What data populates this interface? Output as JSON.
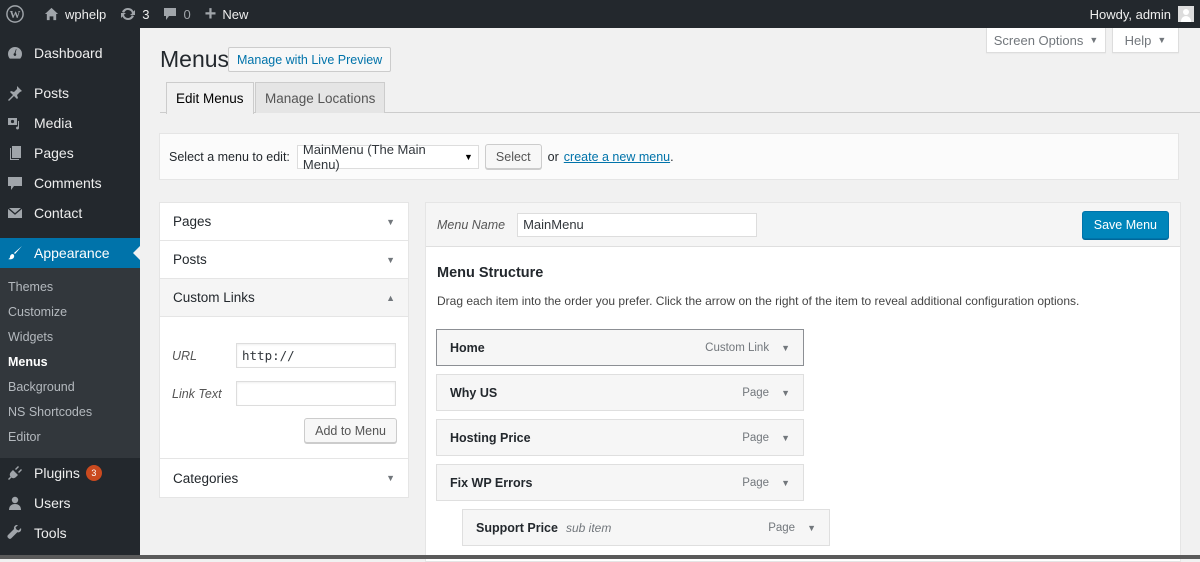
{
  "adminbar": {
    "site_name": "wphelp",
    "updates_count": "3",
    "comments_count": "0",
    "new_label": "New",
    "greeting": "Howdy, admin"
  },
  "sidebar": {
    "items": [
      {
        "label": "Dashboard",
        "icon": "dashboard-icon"
      },
      {
        "label": "Posts",
        "icon": "pin-icon"
      },
      {
        "label": "Media",
        "icon": "media-icon"
      },
      {
        "label": "Pages",
        "icon": "pages-icon"
      },
      {
        "label": "Comments",
        "icon": "comment-icon"
      },
      {
        "label": "Contact",
        "icon": "mail-icon"
      },
      {
        "label": "Appearance",
        "icon": "paintbrush-icon"
      }
    ],
    "appearance_submenu": [
      "Themes",
      "Customize",
      "Widgets",
      "Menus",
      "Background",
      "NS Shortcodes",
      "Editor"
    ],
    "lower_items": [
      {
        "label": "Plugins",
        "icon": "plugin-icon",
        "badge": "3"
      },
      {
        "label": "Users",
        "icon": "user-icon"
      },
      {
        "label": "Tools",
        "icon": "wrench-icon"
      }
    ]
  },
  "screen_meta": {
    "screen_options": "Screen Options",
    "help": "Help"
  },
  "page": {
    "title": "Menus",
    "live_preview": "Manage with Live Preview",
    "tabs": [
      "Edit Menus",
      "Manage Locations"
    ]
  },
  "select_menu": {
    "label": "Select a menu to edit:",
    "selected": "MainMenu (The Main Menu)",
    "select_button": "Select",
    "or_text": "or",
    "create_link": "create a new menu",
    "period": "."
  },
  "accordion": {
    "sections": [
      "Pages",
      "Posts",
      "Custom Links",
      "Categories"
    ],
    "custom_links": {
      "url_label": "URL",
      "url_value": "http://",
      "link_text_label": "Link Text",
      "link_text_value": "",
      "add_button": "Add to Menu"
    }
  },
  "menu_editor": {
    "name_label": "Menu Name",
    "name_value": "MainMenu",
    "save_button": "Save Menu",
    "structure_title": "Menu Structure",
    "structure_desc": "Drag each item into the order you prefer. Click the arrow on the right of the item to reveal additional configuration options.",
    "items": [
      {
        "title": "Home",
        "type": "Custom Link",
        "sub": ""
      },
      {
        "title": "Why US",
        "type": "Page",
        "sub": ""
      },
      {
        "title": "Hosting Price",
        "type": "Page",
        "sub": ""
      },
      {
        "title": "Fix WP Errors",
        "type": "Page",
        "sub": ""
      },
      {
        "title": "Support Price",
        "type": "Page",
        "sub": "sub item"
      }
    ]
  },
  "colors": {
    "accent": "#0073aa",
    "primary_button": "#0085ba",
    "admin_bar": "#23282d",
    "badge": "#ca4a1f"
  }
}
